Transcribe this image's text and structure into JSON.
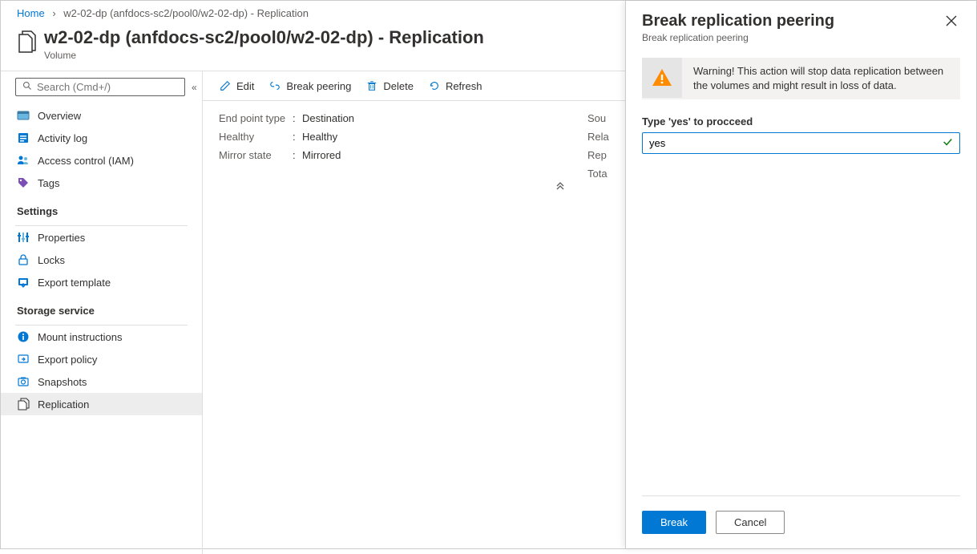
{
  "breadcrumb": {
    "home": "Home",
    "current": "w2-02-dp (anfdocs-sc2/pool0/w2-02-dp) - Replication"
  },
  "header": {
    "title": "w2-02-dp (anfdocs-sc2/pool0/w2-02-dp) - Replication",
    "subtitle": "Volume"
  },
  "search": {
    "placeholder": "Search (Cmd+/)"
  },
  "menu": {
    "top": [
      {
        "label": "Overview"
      },
      {
        "label": "Activity log"
      },
      {
        "label": "Access control (IAM)"
      },
      {
        "label": "Tags"
      }
    ],
    "settings_title": "Settings",
    "settings": [
      {
        "label": "Properties"
      },
      {
        "label": "Locks"
      },
      {
        "label": "Export template"
      }
    ],
    "storage_title": "Storage service",
    "storage": [
      {
        "label": "Mount instructions"
      },
      {
        "label": "Export policy"
      },
      {
        "label": "Snapshots"
      },
      {
        "label": "Replication"
      }
    ]
  },
  "toolbar": {
    "edit": "Edit",
    "break": "Break peering",
    "delete": "Delete",
    "refresh": "Refresh"
  },
  "props": {
    "endpoint_label": "End point type",
    "endpoint_value": "Destination",
    "healthy_label": "Healthy",
    "healthy_value": "Healthy",
    "mirror_label": "Mirror state",
    "mirror_value": "Mirrored",
    "r1": "Sou",
    "r2": "Rela",
    "r3": "Rep",
    "r4": "Tota"
  },
  "panel": {
    "title": "Break replication peering",
    "subtitle": "Break replication peering",
    "warning": "Warning! This action will stop data replication between the volumes and might result in loss of data.",
    "field_label": "Type 'yes' to procceed",
    "input_value": "yes",
    "break_btn": "Break",
    "cancel_btn": "Cancel"
  }
}
